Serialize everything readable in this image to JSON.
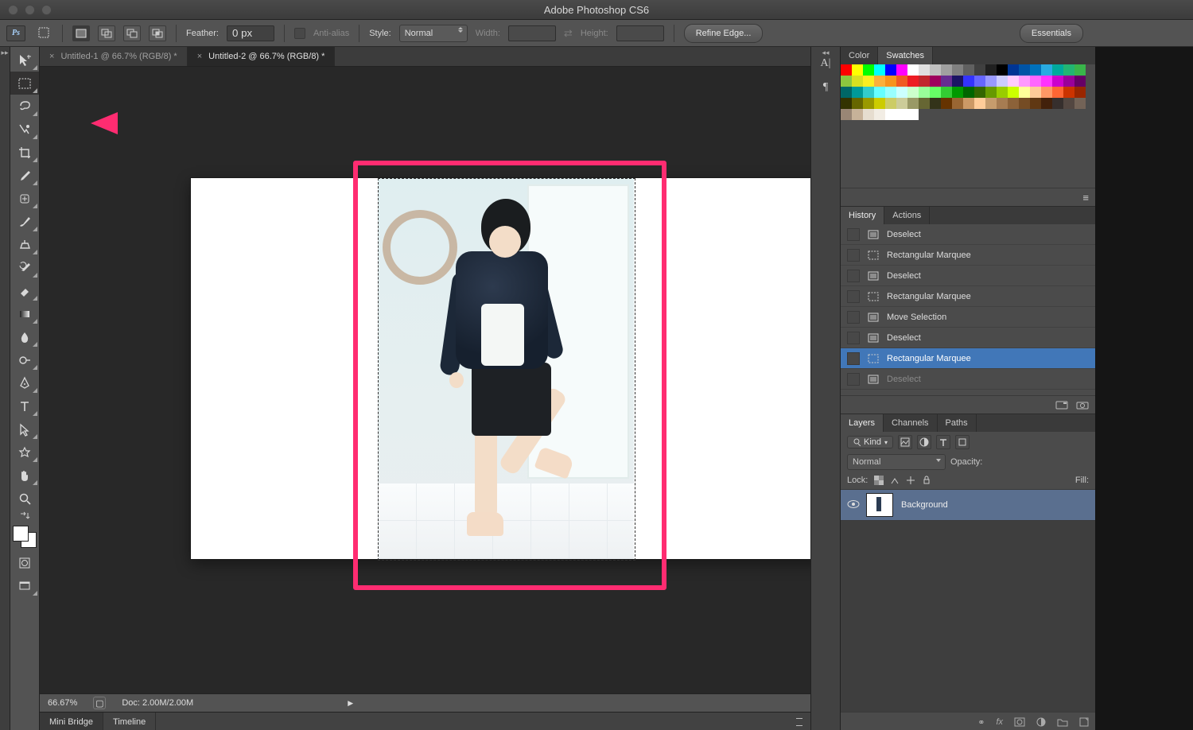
{
  "app_title": "Adobe Photoshop CS6",
  "workspace_button": "Essentials",
  "options": {
    "feather_label": "Feather:",
    "feather_value": "0 px",
    "antialias_label": "Anti-alias",
    "style_label": "Style:",
    "style_value": "Normal",
    "width_label": "Width:",
    "width_value": "",
    "height_label": "Height:",
    "height_value": "",
    "refine_edge": "Refine Edge..."
  },
  "doc_tabs": [
    {
      "label": "Untitled-1 @ 66.7% (RGB/8) *",
      "active": false
    },
    {
      "label": "Untitled-2 @ 66.7% (RGB/8) *",
      "active": true
    }
  ],
  "status": {
    "zoom": "66.67%",
    "doc_info": "Doc: 2.00M/2.00M"
  },
  "bottom_tabs": [
    "Mini Bridge",
    "Timeline"
  ],
  "color_tabs": [
    "Color",
    "Swatches"
  ],
  "history_tabs": [
    "History",
    "Actions"
  ],
  "history_items": [
    {
      "label": "Deselect",
      "type": "menu"
    },
    {
      "label": "Rectangular Marquee",
      "type": "marquee"
    },
    {
      "label": "Deselect",
      "type": "menu"
    },
    {
      "label": "Rectangular Marquee",
      "type": "marquee"
    },
    {
      "label": "Move Selection",
      "type": "menu"
    },
    {
      "label": "Deselect",
      "type": "menu"
    },
    {
      "label": "Rectangular Marquee",
      "type": "marquee",
      "selected": true
    },
    {
      "label": "Deselect",
      "type": "menu",
      "disabled": true
    }
  ],
  "layers_tabs": [
    "Layers",
    "Channels",
    "Paths"
  ],
  "layers": {
    "kind": "Kind",
    "blend": "Normal",
    "opacity_label": "Opacity:",
    "lock_label": "Lock:",
    "fill_label": "Fill:",
    "layer0": "Background"
  },
  "swatch_rows": [
    [
      "#ff0000",
      "#ffff00",
      "#00ff00",
      "#00ffff",
      "#0000ff",
      "#ff00ff",
      "#ffffff",
      "#e0e0e0",
      "#c0c0c0",
      "#a0a0a0",
      "#808080",
      "#606060",
      "#404040",
      "#202020",
      "#000000",
      "#003594",
      "#0054a6",
      "#0071bc",
      "#29abe2",
      "#00a99d",
      "#22b573",
      "#39b54a"
    ],
    [
      "#8cc63f",
      "#d9e021",
      "#fcee21",
      "#fbb03b",
      "#f7931e",
      "#f15a24",
      "#ed1c24",
      "#c1272d",
      "#9e005d",
      "#662d91",
      "#1b1464",
      "#3333ff",
      "#6666ff",
      "#9999ff",
      "#ccccff",
      "#ffccff",
      "#ff99ff",
      "#ff66ff",
      "#ff33ff",
      "#cc00cc",
      "#990099",
      "#660066"
    ],
    [
      "#006666",
      "#009999",
      "#33cccc",
      "#66ffff",
      "#99ffff",
      "#ccffff",
      "#ccffcc",
      "#99ff99",
      "#66ff66",
      "#33cc33",
      "#009900",
      "#006600",
      "#336600",
      "#669900",
      "#99cc00",
      "#ccff00",
      "#ffff99",
      "#ffcc99",
      "#ff9966",
      "#ff6633",
      "#cc3300",
      "#992600"
    ],
    [
      "#333300",
      "#666600",
      "#999900",
      "#cccc00",
      "#cccc66",
      "#cccc99",
      "#999966",
      "#666633",
      "#333319",
      "#663300",
      "#996633",
      "#cc9966",
      "#ffcc99",
      "#c69c6d",
      "#a67c52",
      "#8c6239",
      "#754c24",
      "#603813",
      "#42210b",
      "#362f2d",
      "#534741",
      "#736357"
    ],
    [
      "#998675",
      "#c7b299",
      "#e6ddcf",
      "#f2ede4",
      "#fff",
      "#fff",
      "#fff",
      "",
      "",
      "",
      "",
      "",
      "",
      "",
      "",
      "",
      "",
      "",
      "",
      "",
      "",
      ""
    ]
  ]
}
